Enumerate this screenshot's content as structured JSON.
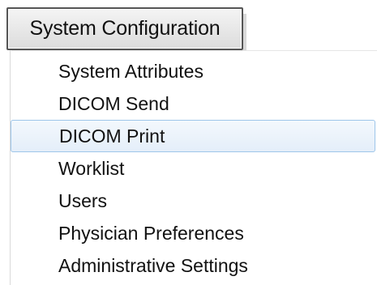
{
  "menu": {
    "button_label": "System Configuration",
    "items": [
      {
        "label": "System Attributes",
        "selected": false
      },
      {
        "label": "DICOM Send",
        "selected": false
      },
      {
        "label": "DICOM Print",
        "selected": true
      },
      {
        "label": "Worklist",
        "selected": false
      },
      {
        "label": "Users",
        "selected": false
      },
      {
        "label": "Physician Preferences",
        "selected": false
      },
      {
        "label": "Administrative Settings",
        "selected": false
      }
    ]
  },
  "colors": {
    "selected_border": "#9ec6ea",
    "selected_fill": "#e4eef9",
    "button_border": "#555555"
  }
}
